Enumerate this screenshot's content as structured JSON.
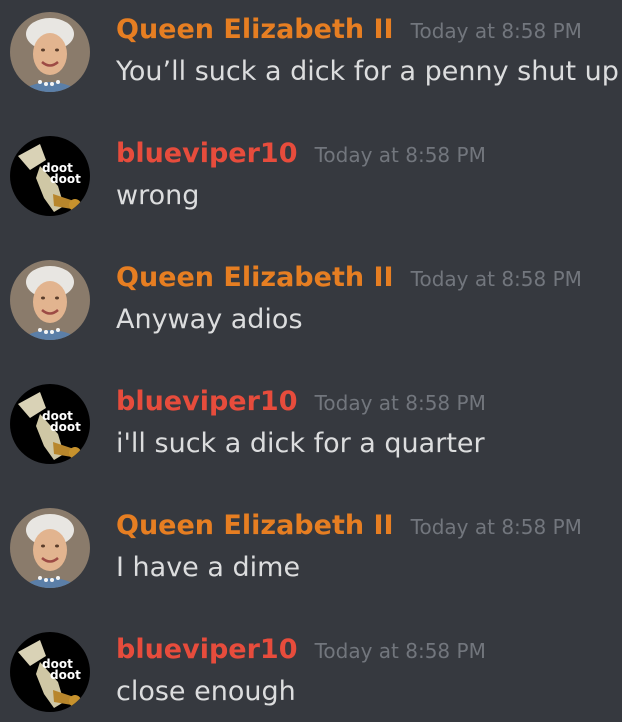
{
  "colors": {
    "background": "#36393f",
    "username": "#e67e22",
    "username_alt": "#e74c3c",
    "timestamp": "#72767d",
    "text": "#dcddde"
  },
  "messages": [
    {
      "author": "Queen Elizabeth II",
      "author_color": "#e67e22",
      "avatar_icon": "queen-portrait-icon",
      "timestamp": "Today at 8:58 PM",
      "content": "You’ll suck a dick for a penny shut up"
    },
    {
      "author": "blueviper10",
      "author_color": "#e74c3c",
      "avatar_icon": "doot-skeleton-icon",
      "avatar_text_1": "doot",
      "avatar_text_2": "doot",
      "timestamp": "Today at 8:58 PM",
      "content": "wrong"
    },
    {
      "author": "Queen Elizabeth II",
      "author_color": "#e67e22",
      "avatar_icon": "queen-portrait-icon",
      "timestamp": "Today at 8:58 PM",
      "content": "Anyway adios"
    },
    {
      "author": "blueviper10",
      "author_color": "#e74c3c",
      "avatar_icon": "doot-skeleton-icon",
      "avatar_text_1": "doot",
      "avatar_text_2": "doot",
      "timestamp": "Today at 8:58 PM",
      "content": "i'll suck a dick for a quarter"
    },
    {
      "author": "Queen Elizabeth II",
      "author_color": "#e67e22",
      "avatar_icon": "queen-portrait-icon",
      "timestamp": "Today at 8:58 PM",
      "content": "I have a dime"
    },
    {
      "author": "blueviper10",
      "author_color": "#e74c3c",
      "avatar_icon": "doot-skeleton-icon",
      "avatar_text_1": "doot",
      "avatar_text_2": "doot",
      "timestamp": "Today at 8:58 PM",
      "content": "close enough"
    }
  ]
}
